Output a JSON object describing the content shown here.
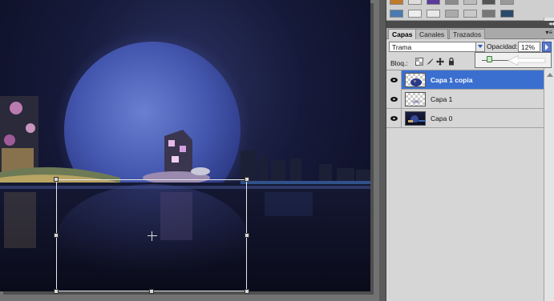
{
  "panels": {
    "tabs": [
      {
        "label": "Capas",
        "active": true
      },
      {
        "label": "Canales",
        "active": false
      },
      {
        "label": "Trazados",
        "active": false
      }
    ],
    "collapse_icon": "double-chevron-right-icon",
    "menu_icon": "panel-menu-icon"
  },
  "layer_options": {
    "blend_mode": "Trama",
    "opacity_label": "Opacidad:",
    "opacity_value": "12%",
    "opacity_level_percent": 12,
    "lock_label": "Bloq.:"
  },
  "layers": [
    {
      "name": "Capa 1 copia",
      "selected": true,
      "visible": true,
      "thumbnail": "moon-transparent"
    },
    {
      "name": "Capa 1",
      "selected": false,
      "visible": true,
      "thumbnail": "transparent"
    },
    {
      "name": "Capa 0",
      "selected": false,
      "visible": true,
      "thumbnail": "night-city-photo"
    }
  ],
  "colors": {
    "selection_highlight": "#3a6fd0",
    "panel_bg": "#d6d6d6",
    "workspace_bg": "#727272"
  }
}
